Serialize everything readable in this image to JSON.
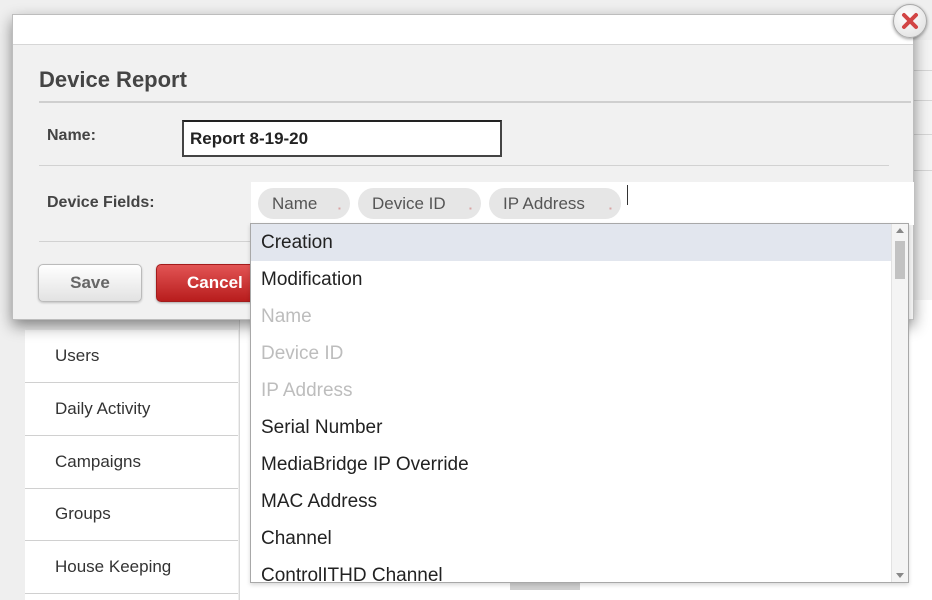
{
  "modal": {
    "title": "Device Report",
    "name_label": "Name:",
    "name_value": "Report 8-19-20",
    "fields_label": "Device Fields:",
    "chips": [
      {
        "label": "Name"
      },
      {
        "label": "Device ID"
      },
      {
        "label": "IP Address"
      }
    ],
    "chip_remove_glyph": "▪",
    "save_label": "Save",
    "cancel_label": "Cancel",
    "close_icon": "close-x-icon"
  },
  "dropdown": {
    "options": [
      {
        "label": "Creation",
        "state": "highlighted"
      },
      {
        "label": "Modification",
        "state": "normal"
      },
      {
        "label": "Name",
        "state": "disabled"
      },
      {
        "label": "Device ID",
        "state": "disabled"
      },
      {
        "label": "IP Address",
        "state": "disabled"
      },
      {
        "label": "Serial Number",
        "state": "normal"
      },
      {
        "label": "MediaBridge IP Override",
        "state": "normal"
      },
      {
        "label": "MAC Address",
        "state": "normal"
      },
      {
        "label": "Channel",
        "state": "normal"
      },
      {
        "label": "ControlITHD Channel",
        "state": "normal"
      }
    ]
  },
  "sidebar": {
    "items": [
      {
        "label": "Users"
      },
      {
        "label": "Daily Activity"
      },
      {
        "label": "Campaigns"
      },
      {
        "label": "Groups"
      },
      {
        "label": "House Keeping"
      }
    ]
  },
  "colors": {
    "cancel": "#c62828",
    "highlight": "#e2e6ee",
    "close_x": "#d24545"
  }
}
